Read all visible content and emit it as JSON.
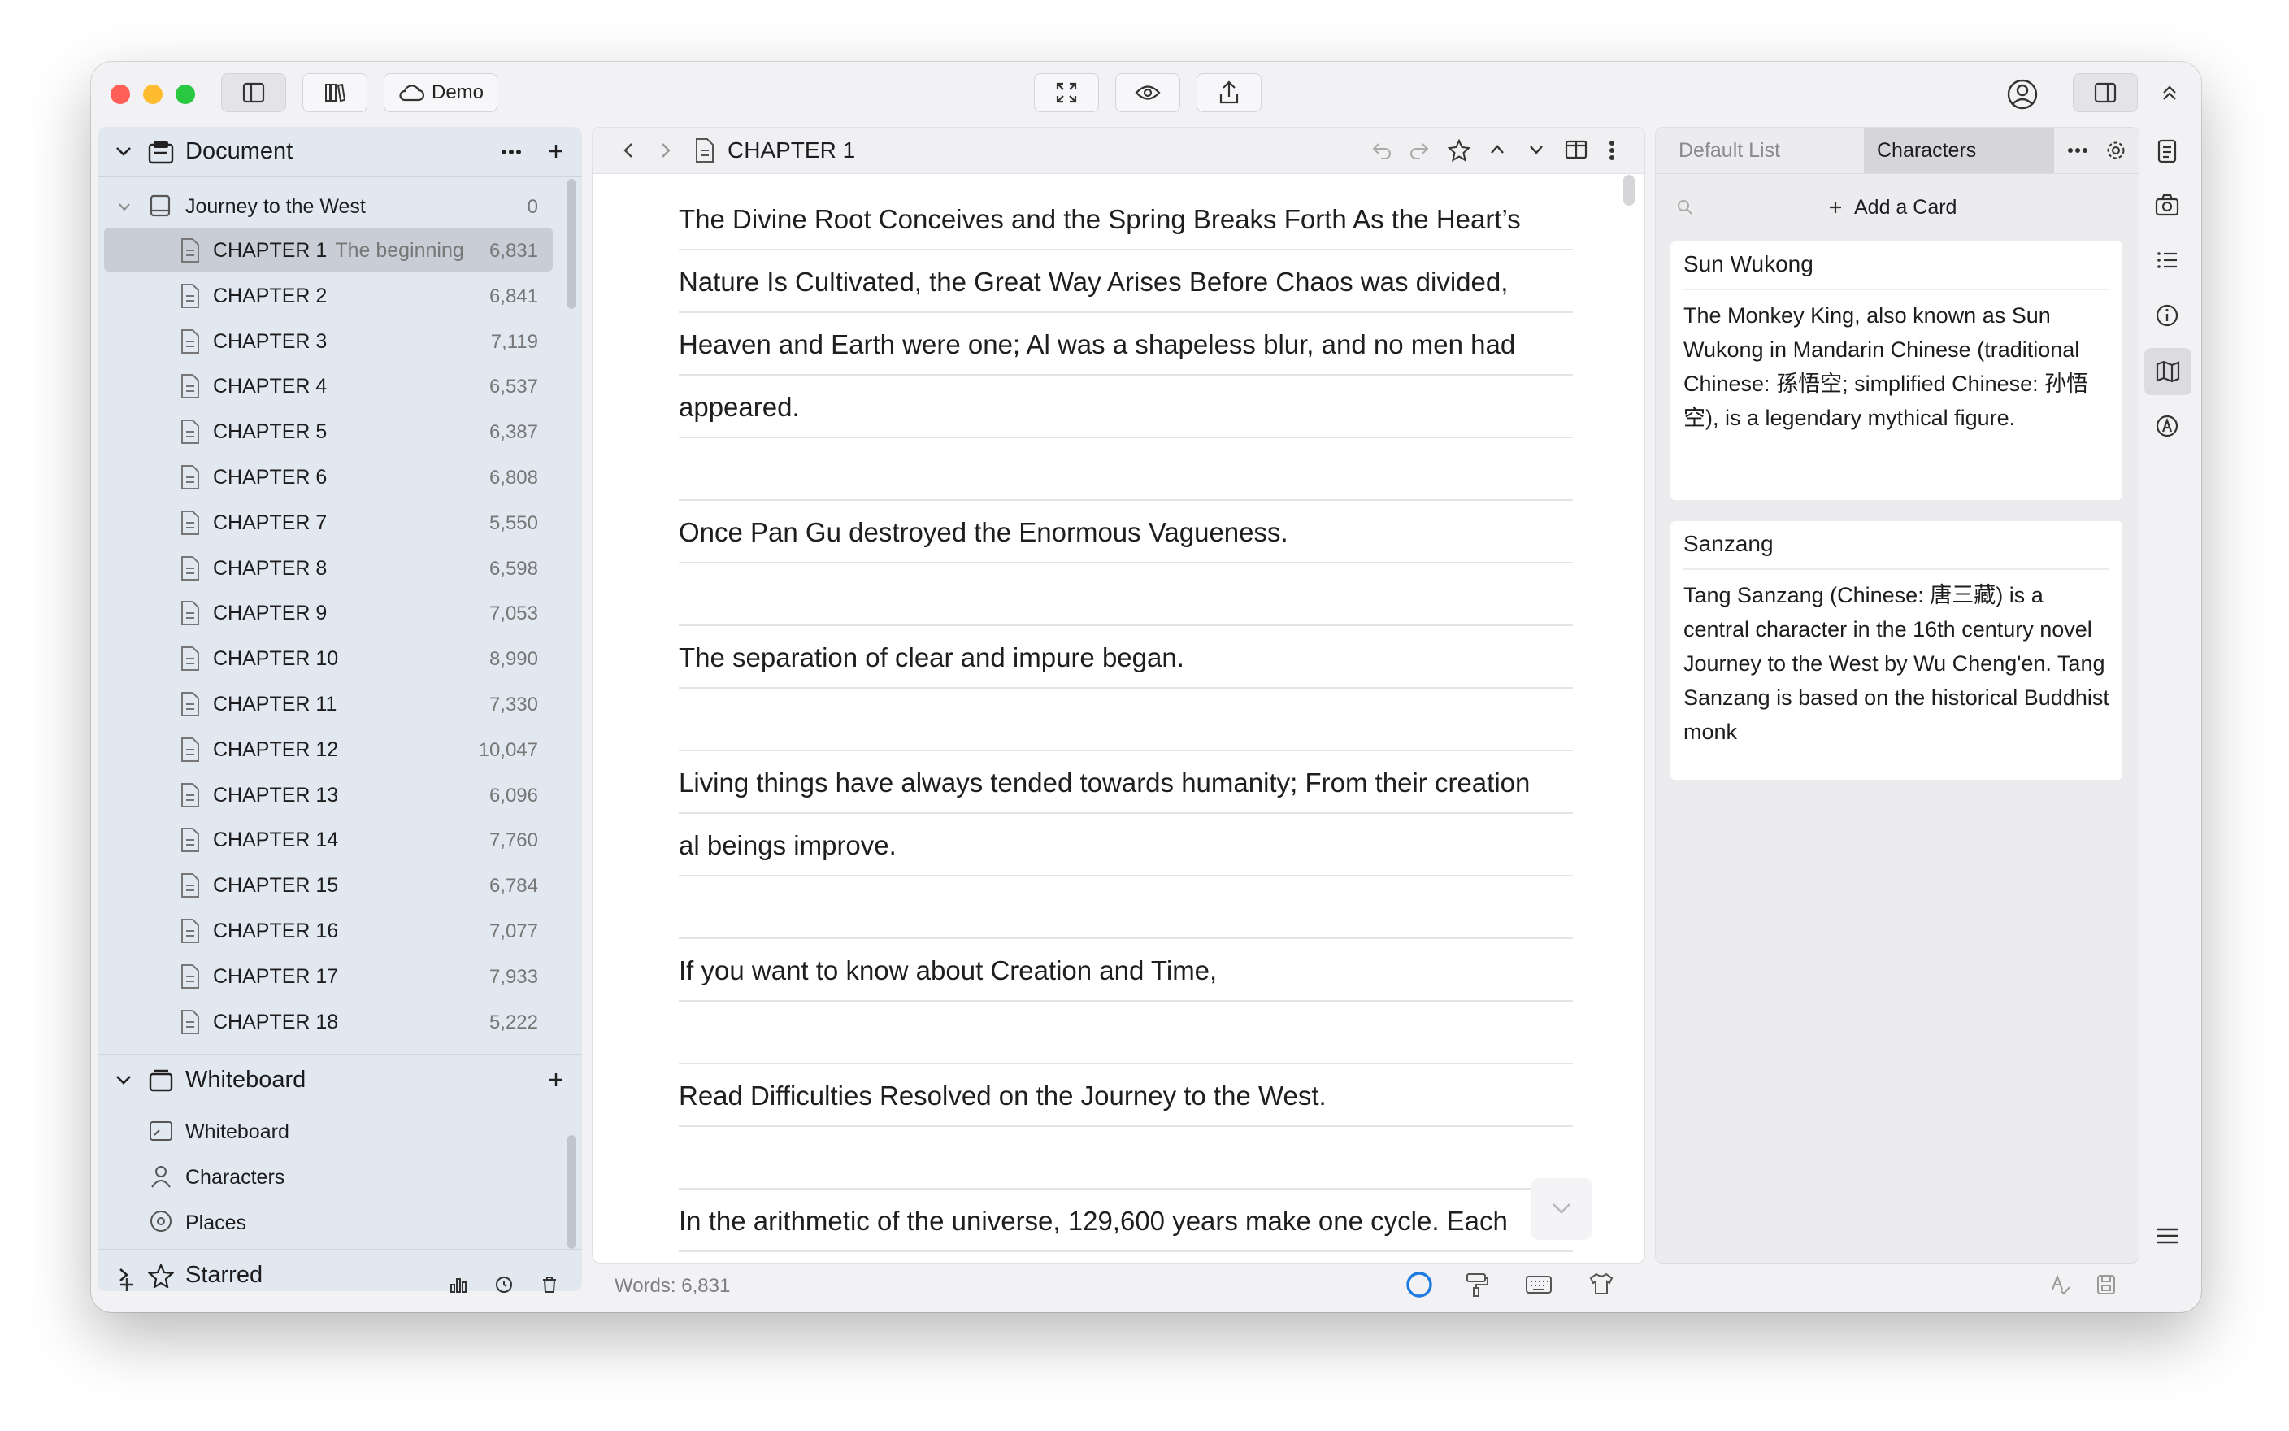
{
  "toolbar": {
    "demo_label": "Demo"
  },
  "sidebar": {
    "document_section": {
      "title": "Document",
      "project": {
        "title": "Journey to the West",
        "count": "0"
      },
      "chapters": [
        {
          "title": "CHAPTER 1",
          "subtitle": "The beginning",
          "count": "6,831",
          "selected": true
        },
        {
          "title": "CHAPTER 2",
          "subtitle": "",
          "count": "6,841"
        },
        {
          "title": "CHAPTER 3",
          "subtitle": "",
          "count": "7,119"
        },
        {
          "title": "CHAPTER 4",
          "subtitle": "",
          "count": "6,537"
        },
        {
          "title": "CHAPTER 5",
          "subtitle": "",
          "count": "6,387"
        },
        {
          "title": "CHAPTER 6",
          "subtitle": "",
          "count": "6,808"
        },
        {
          "title": "CHAPTER 7",
          "subtitle": "",
          "count": "5,550"
        },
        {
          "title": "CHAPTER 8",
          "subtitle": "",
          "count": "6,598"
        },
        {
          "title": "CHAPTER 9",
          "subtitle": "",
          "count": "7,053"
        },
        {
          "title": "CHAPTER 10",
          "subtitle": "",
          "count": "8,990"
        },
        {
          "title": "CHAPTER 11",
          "subtitle": "",
          "count": "7,330"
        },
        {
          "title": "CHAPTER 12",
          "subtitle": "",
          "count": "10,047"
        },
        {
          "title": "CHAPTER 13",
          "subtitle": "",
          "count": "6,096"
        },
        {
          "title": "CHAPTER 14",
          "subtitle": "",
          "count": "7,760"
        },
        {
          "title": "CHAPTER 15",
          "subtitle": "",
          "count": "6,784"
        },
        {
          "title": "CHAPTER 16",
          "subtitle": "",
          "count": "7,077"
        },
        {
          "title": "CHAPTER 17",
          "subtitle": "",
          "count": "7,933"
        },
        {
          "title": "CHAPTER 18",
          "subtitle": "",
          "count": "5,222"
        }
      ]
    },
    "whiteboard_section": {
      "title": "Whiteboard",
      "items": [
        {
          "label": "Whiteboard",
          "icon": "whiteboard-icon"
        },
        {
          "label": "Characters",
          "icon": "person-icon"
        },
        {
          "label": "Places",
          "icon": "pin-icon"
        }
      ]
    },
    "starred_section": {
      "title": "Starred"
    }
  },
  "editor": {
    "title": "CHAPTER 1",
    "lines": [
      "The Divine Root Conceives and the Spring Breaks Forth As the Heart’s",
      "Nature Is Cultivated, the Great Way Arises Before Chaos was divided,",
      "Heaven and Earth were one; Al was a shapeless blur, and no men had",
      "appeared.",
      "",
      "Once Pan Gu destroyed the Enormous Vagueness.",
      "",
      "The separation of clear and impure began.",
      "",
      "Living things have always tended towards humanity; From their creation",
      "al beings improve.",
      "",
      "If you want to know about Creation and Time,",
      "",
      "Read Difficulties Resolved on the Journey to the West.",
      "",
      "In the arithmetic of the universe, 129,600 years make one cycle. Each"
    ],
    "footer_words": "Words: 6,831"
  },
  "right_panel": {
    "tabs": [
      {
        "label": "Default List",
        "active": false
      },
      {
        "label": "Characters",
        "active": true
      }
    ],
    "add_card_label": "Add a Card",
    "cards": [
      {
        "name": "Sun Wukong",
        "description": "The Monkey King, also known as Sun Wukong in Mandarin Chinese (traditional Chinese: 孫悟空; simplified Chinese: 孙悟空), is a legendary mythical figure."
      },
      {
        "name": "Sanzang",
        "description": "Tang Sanzang (Chinese: 唐三藏) is a central character in the 16th century novel Journey to the West by Wu Cheng'en. Tang Sanzang is based on the historical Buddhist monk"
      }
    ]
  },
  "colors": {
    "close": "#ff5f57",
    "minimize": "#febc2e",
    "zoom": "#28c840",
    "sidebar_bg": "#e2e8f0",
    "selection": "#c9ced6",
    "progress_ring": "#1f7ae0"
  }
}
